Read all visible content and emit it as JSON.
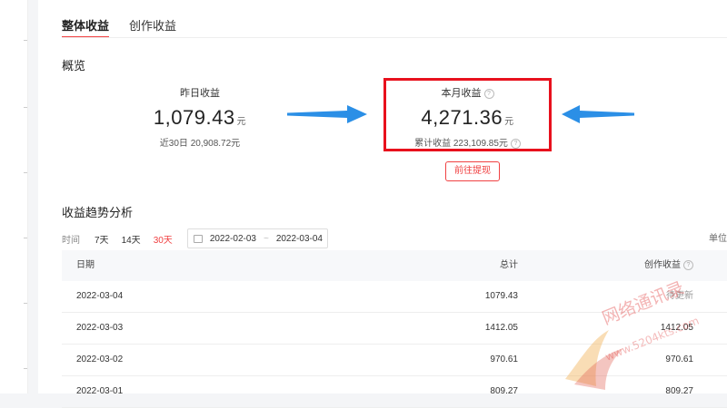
{
  "tabs": [
    "整体收益",
    "创作收益"
  ],
  "overview": {
    "title": "概览",
    "yesterday": {
      "label": "昨日收益",
      "value": "1,079.43",
      "unit": "元",
      "sub": "近30日 20,908.72元"
    },
    "month": {
      "label": "本月收益",
      "value": "4,271.36",
      "unit": "元",
      "sub": "累计收益 223,109.85元"
    },
    "withdraw_button": "前往提现"
  },
  "trend": {
    "title": "收益趋势分析",
    "time_label": "时间",
    "ranges": [
      "7天",
      "14天",
      "30天"
    ],
    "active_range": "30天",
    "date_start": "2022-02-03",
    "date_sep": "~",
    "date_end": "2022-03-04",
    "unit_label": "单位"
  },
  "table": {
    "headers": {
      "date": "日期",
      "total": "总计",
      "create": "创作收益"
    },
    "rows": [
      {
        "date": "2022-03-04",
        "total": "1079.43",
        "create": "待更新"
      },
      {
        "date": "2022-03-03",
        "total": "1412.05",
        "create": "1412.05"
      },
      {
        "date": "2022-03-02",
        "total": "970.61",
        "create": "970.61"
      },
      {
        "date": "2022-03-01",
        "total": "809.27",
        "create": "809.27"
      }
    ]
  },
  "watermark": {
    "text": "网络通讯录",
    "url": "www.5204kts.com"
  },
  "colors": {
    "accent": "#f04142",
    "highlight_box": "#e8111d",
    "arrow": "#2b8fe6"
  }
}
